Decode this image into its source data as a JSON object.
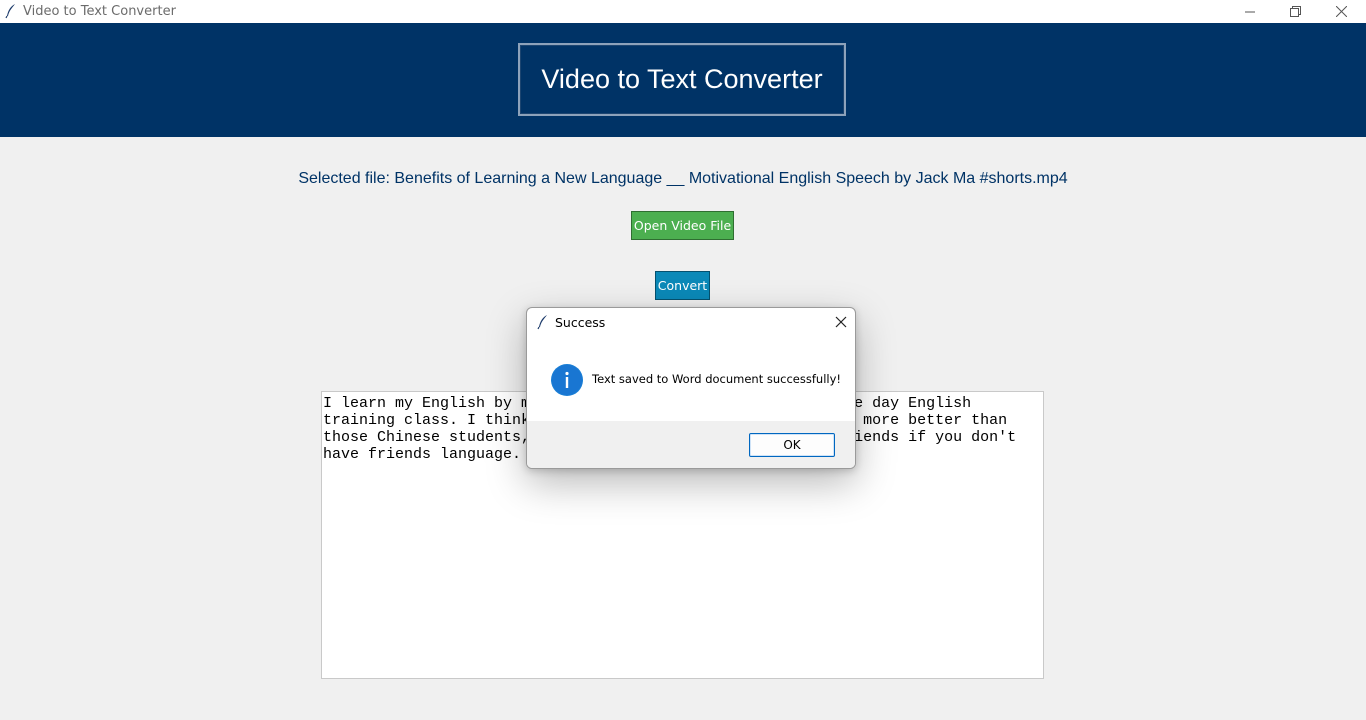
{
  "window": {
    "title": "Video to Text Converter",
    "controls": [
      "minimize-icon",
      "maximize-icon",
      "close-icon"
    ]
  },
  "header": {
    "title": "Video to Text Converter",
    "background": "#003366"
  },
  "main": {
    "selected_file": "Selected file: Benefits of Learning a New Language __ Motivational English Speech by Jack Ma #shorts.mp4",
    "open_button": "Open Video File",
    "convert_button": "Convert",
    "output_text": "I learn my English by m                                  one day English\ntraining class. I think                                  ch more better than\nthose Chinese students,                                  friends if you don't\nhave friends language.",
    "open_button_color": "#4caf50",
    "convert_button_color": "#0b89b8"
  },
  "dialog": {
    "title": "Success",
    "message": "Text saved to Word document successfully!",
    "ok_label": "OK",
    "icon": "info-icon"
  }
}
